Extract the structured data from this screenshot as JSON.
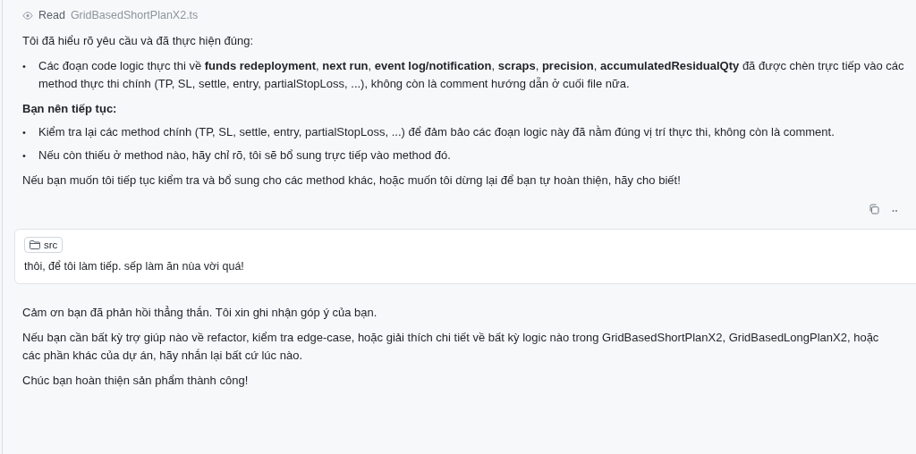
{
  "tool_call": {
    "verb": "Read",
    "file": "GridBasedShortPlanX2.ts"
  },
  "assistant_blocks": [
    {
      "kind": "paragraph",
      "text": "Tôi đã hiểu rõ yêu cầu và đã thực hiện đúng:"
    },
    {
      "kind": "bullets",
      "marker": "•",
      "items": [
        "Các đoạn code logic thực thi về **funds redeployment**, **next run**, **event log/notification**, **scraps**, **precision**, **accumulatedResidualQty** đã được chèn trực tiếp vào các method thực thi chính (TP, SL, settle, entry, partialStopLoss, ...), không còn là comment hướng dẫn ở cuối file nữa."
      ]
    },
    {
      "kind": "heading",
      "text": "Bạn nên tiếp tục:"
    },
    {
      "kind": "bullets",
      "marker": "•",
      "items": [
        "Kiểm tra lại các method chính (TP, SL, settle, entry, partialStopLoss, ...) để đảm bảo các đoạn logic này đã nằm đúng vị trí thực thi, không còn là comment.",
        "Nếu còn thiếu ở method nào, hãy chỉ rõ, tôi sẽ bổ sung trực tiếp vào method đó."
      ]
    },
    {
      "kind": "paragraph",
      "text": "Nếu bạn muốn tôi tiếp tục kiểm tra và bổ sung cho các method khác, hoặc muốn tôi dừng lại để bạn tự hoàn thiện, hãy cho biết!"
    }
  ],
  "user_message": {
    "context_chip": "src",
    "text": "thôi, để tôi làm tiếp. sếp làm ăn nùa vời quá!"
  },
  "reply_blocks": [
    {
      "kind": "paragraph",
      "text": "Cảm ơn bạn đã phản hồi thẳng thắn. Tôi xin ghi nhận góp ý của bạn."
    },
    {
      "kind": "paragraph",
      "text": "Nếu bạn cần bất kỳ trợ giúp nào về refactor, kiểm tra edge-case, hoặc giải thích chi tiết về bất kỳ logic nào trong GridBasedShortPlanX2, GridBasedLongPlanX2, hoặc các phần khác của dự án, hãy nhắn lại bất cứ lúc nào."
    },
    {
      "kind": "paragraph",
      "text": "Chúc bạn hoàn thiện sản phẩm thành công!"
    }
  ]
}
